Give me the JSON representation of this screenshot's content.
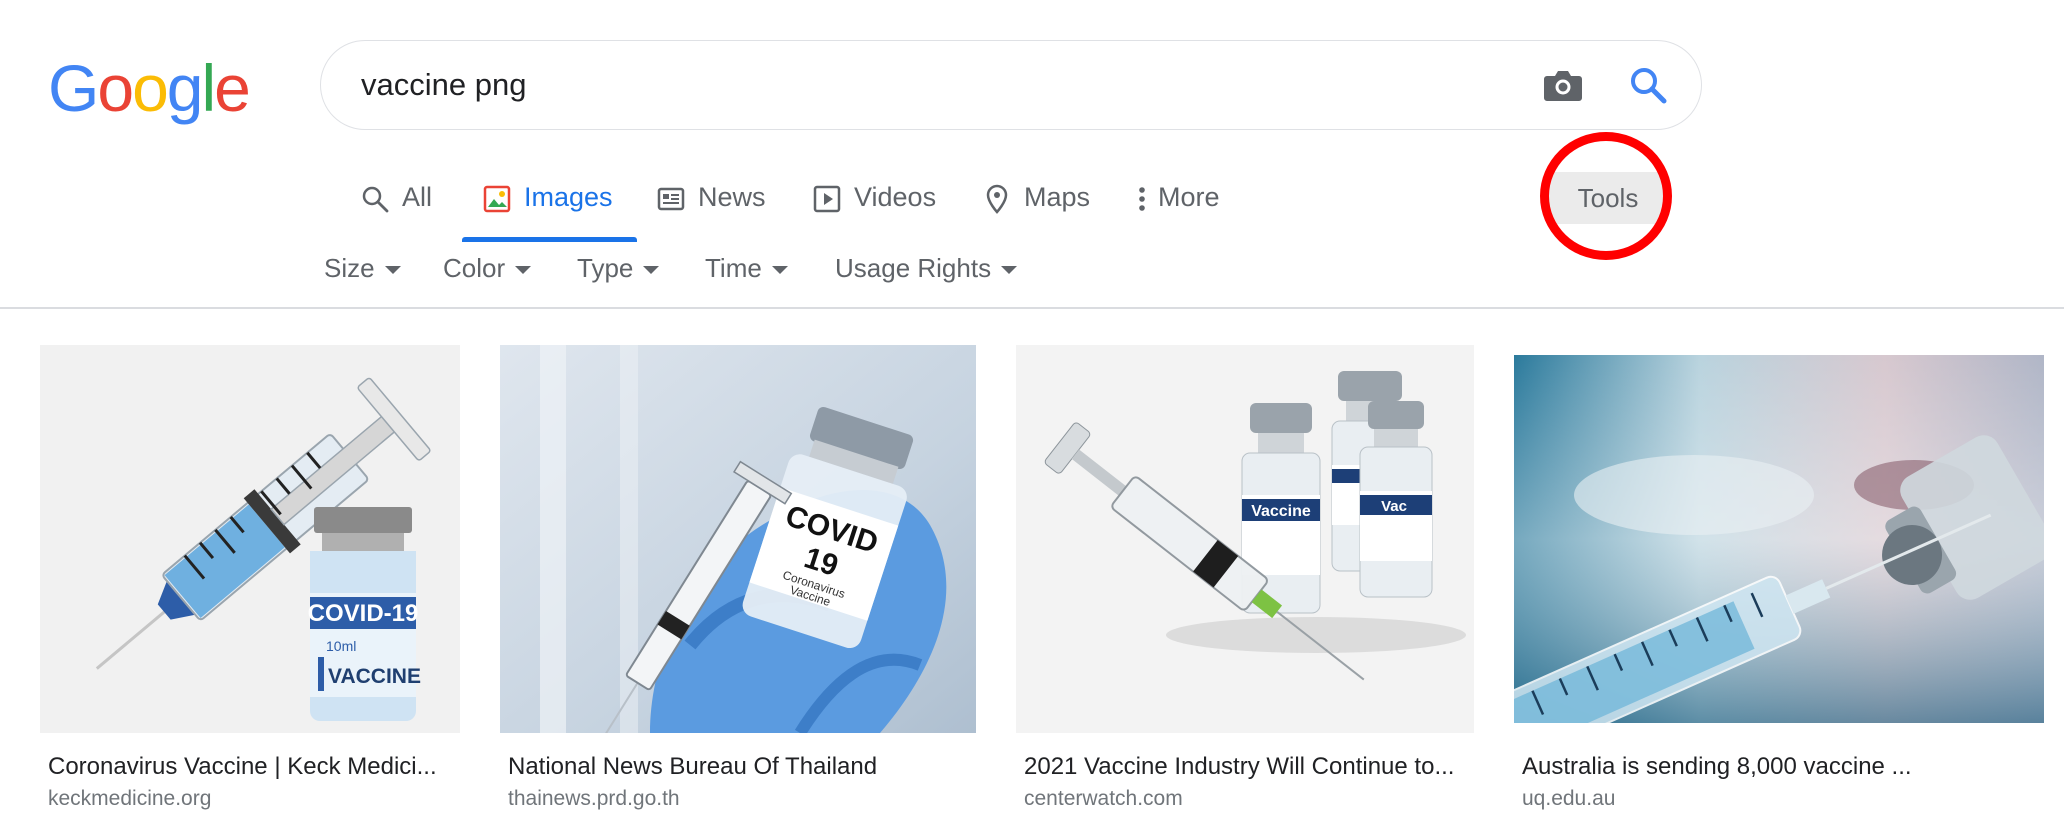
{
  "logo": {
    "letters": [
      "G",
      "o",
      "o",
      "g",
      "l",
      "e"
    ],
    "colors": [
      "#4285f4",
      "#ea4335",
      "#fbbc05",
      "#4285f4",
      "#34a853",
      "#ea4335"
    ]
  },
  "search": {
    "query": "vaccine png"
  },
  "icons": {
    "camera": "camera-icon",
    "search": "search-icon"
  },
  "tabs": [
    {
      "label": "All",
      "icon": "search-icon"
    },
    {
      "label": "Images",
      "icon": "image-icon",
      "active": true
    },
    {
      "label": "News",
      "icon": "newspaper-icon"
    },
    {
      "label": "Videos",
      "icon": "play-icon"
    },
    {
      "label": "Maps",
      "icon": "map-pin-icon"
    },
    {
      "label": "More",
      "icon": "vertical-dots-icon"
    }
  ],
  "tools": {
    "label": "Tools"
  },
  "filters": [
    "Size",
    "Color",
    "Type",
    "Time",
    "Usage Rights"
  ],
  "colors": {
    "accent": "#1a73e8",
    "highlight": "#ff0000",
    "text_secondary": "#5f6368"
  },
  "results": [
    {
      "title": "Coronavirus Vaccine | Keck Medici...",
      "source": "keckmedicine.org"
    },
    {
      "title": "National News Bureau Of Thailand",
      "source": "thainews.prd.go.th"
    },
    {
      "title": "2021 Vaccine Industry Will Continue to...",
      "source": "centerwatch.com"
    },
    {
      "title": "Australia is sending 8,000 vaccine ...",
      "source": "uq.edu.au"
    }
  ],
  "thumb_text": {
    "r1_label1": "COVID-19",
    "r1_label2": "10ml",
    "r1_label3": "VACCINE",
    "r2_label1": "COVID",
    "r2_label2": "19",
    "r2_label3": "Coronavirus",
    "r2_label4": "Vaccine",
    "r3_label1": "Vaccine",
    "r3_label2": "Vac"
  }
}
